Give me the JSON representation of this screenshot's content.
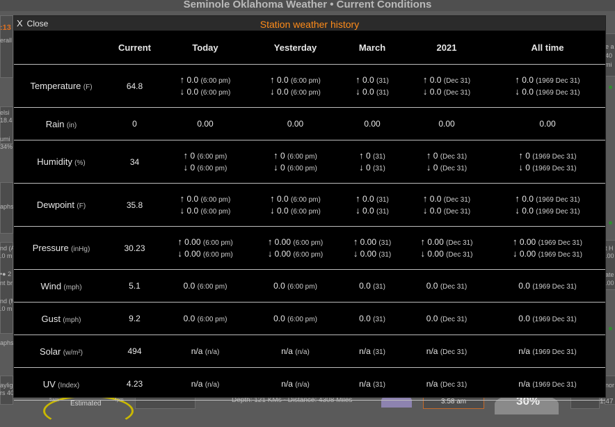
{
  "background": {
    "title": "Seminole Oklahoma Weather  •  Current Conditions",
    "fragments": {
      "top_left": ":13",
      "left_1": "erall",
      "left_2": "elsi",
      "left_3": "18.4",
      "left_4": "umi",
      "left_5": "34%",
      "left_6": "aphs",
      "left_7": "nd (A",
      "left_8": ".0 m",
      "left_9": "•● 2",
      "left_10": "nt br",
      "left_11": "nd (M",
      "left_12": ".0 m",
      "left_13": "aphs",
      "left_14": "ayligi",
      "left_15": "rs 40",
      "right_1": "e a",
      "right_2": "40",
      "right_3": "mi",
      "right_4": "t H",
      "right_5": ".00",
      "right_6": "ate",
      "right_7": ".00",
      "right_8": "nor",
      "right_9": "1:47",
      "bottom_estimated": "Estimated",
      "bottom_sam": "5am",
      "bottom_4pm": "4pm",
      "bottom_depth": "Depth: 121 KMs - Distance: 4308 Miles",
      "bottom_time": "3:58 am",
      "bottom_pct": "30%"
    }
  },
  "modal": {
    "close_label": "Close",
    "close_icon": "X",
    "title": "Station weather history",
    "title_color": "#ff8c1a",
    "columns": [
      "",
      "Current",
      "Today",
      "Yesterday",
      "March",
      "2021",
      "All time"
    ],
    "rows": [
      {
        "key": "temperature",
        "label": "Temperature",
        "unit": "(F)",
        "current": "64.8",
        "cells": [
          {
            "hi": "0.0",
            "hi_t": "(6:00 pm)",
            "lo": "0.0",
            "lo_t": "(6:00 pm)"
          },
          {
            "hi": "0.0",
            "hi_t": "(6:00 pm)",
            "lo": "0.0",
            "lo_t": "(6:00 pm)"
          },
          {
            "hi": "0.0",
            "hi_t": "(31)",
            "lo": "0.0",
            "lo_t": "(31)"
          },
          {
            "hi": "0.0",
            "hi_t": "(Dec 31)",
            "lo": "0.0",
            "lo_t": "(Dec 31)"
          },
          {
            "hi": "0.0",
            "hi_t": "(1969 Dec 31)",
            "lo": "0.0",
            "lo_t": "(1969 Dec 31)"
          }
        ]
      },
      {
        "key": "rain",
        "label": "Rain",
        "unit": "(in)",
        "current": "0",
        "cells": [
          {
            "v": "0.00"
          },
          {
            "v": "0.00"
          },
          {
            "v": "0.00"
          },
          {
            "v": "0.00"
          },
          {
            "v": "0.00"
          }
        ]
      },
      {
        "key": "humidity",
        "label": "Humidity",
        "unit": "(%)",
        "current": "34",
        "cells": [
          {
            "hi": "0",
            "hi_t": "(6:00 pm)",
            "lo": "0",
            "lo_t": "(6:00 pm)"
          },
          {
            "hi": "0",
            "hi_t": "(6:00 pm)",
            "lo": "0",
            "lo_t": "(6:00 pm)"
          },
          {
            "hi": "0",
            "hi_t": "(31)",
            "lo": "0",
            "lo_t": "(31)"
          },
          {
            "hi": "0",
            "hi_t": "(Dec 31)",
            "lo": "0",
            "lo_t": "(Dec 31)"
          },
          {
            "hi": "0",
            "hi_t": "(1969 Dec 31)",
            "lo": "0",
            "lo_t": "(1969 Dec 31)"
          }
        ]
      },
      {
        "key": "dewpoint",
        "label": "Dewpoint",
        "unit": "(F)",
        "current": "35.8",
        "cells": [
          {
            "hi": "0.0",
            "hi_t": "(6:00 pm)",
            "lo": "0.0",
            "lo_t": "(6:00 pm)"
          },
          {
            "hi": "0.0",
            "hi_t": "(6:00 pm)",
            "lo": "0.0",
            "lo_t": "(6:00 pm)"
          },
          {
            "hi": "0.0",
            "hi_t": "(31)",
            "lo": "0.0",
            "lo_t": "(31)"
          },
          {
            "hi": "0.0",
            "hi_t": "(Dec 31)",
            "lo": "0.0",
            "lo_t": "(Dec 31)"
          },
          {
            "hi": "0.0",
            "hi_t": "(1969 Dec 31)",
            "lo": "0.0",
            "lo_t": "(1969 Dec 31)"
          }
        ]
      },
      {
        "key": "pressure",
        "label": "Pressure",
        "unit": "(inHg)",
        "current": "30.23",
        "cells": [
          {
            "hi": "0.00",
            "hi_t": "(6:00 pm)",
            "lo": "0.00",
            "lo_t": "(6:00 pm)"
          },
          {
            "hi": "0.00",
            "hi_t": "(6:00 pm)",
            "lo": "0.00",
            "lo_t": "(6:00 pm)"
          },
          {
            "hi": "0.00",
            "hi_t": "(31)",
            "lo": "0.00",
            "lo_t": "(31)"
          },
          {
            "hi": "0.00",
            "hi_t": "(Dec 31)",
            "lo": "0.00",
            "lo_t": "(Dec 31)"
          },
          {
            "hi": "0.00",
            "hi_t": "(1969 Dec 31)",
            "lo": "0.00",
            "lo_t": "(1969 Dec 31)"
          }
        ]
      },
      {
        "key": "wind",
        "label": "Wind",
        "unit": "(mph)",
        "current": "5.1",
        "cells": [
          {
            "v": "0.0",
            "t": "(6:00 pm)"
          },
          {
            "v": "0.0",
            "t": "(6:00 pm)"
          },
          {
            "v": "0.0",
            "t": "(31)"
          },
          {
            "v": "0.0",
            "t": "(Dec 31)"
          },
          {
            "v": "0.0",
            "t": "(1969 Dec 31)"
          }
        ]
      },
      {
        "key": "gust",
        "label": "Gust",
        "unit": "(mph)",
        "current": "9.2",
        "cells": [
          {
            "v": "0.0",
            "t": "(6:00 pm)"
          },
          {
            "v": "0.0",
            "t": "(6:00 pm)"
          },
          {
            "v": "0.0",
            "t": "(31)"
          },
          {
            "v": "0.0",
            "t": "(Dec 31)"
          },
          {
            "v": "0.0",
            "t": "(1969 Dec 31)"
          }
        ]
      },
      {
        "key": "solar",
        "label": "Solar",
        "unit": "(w/m²)",
        "current": "494",
        "cells": [
          {
            "v": "n/a",
            "t": "(n/a)"
          },
          {
            "v": "n/a",
            "t": "(n/a)"
          },
          {
            "v": "n/a",
            "t": "(31)"
          },
          {
            "v": "n/a",
            "t": "(Dec 31)"
          },
          {
            "v": "n/a",
            "t": "(1969 Dec 31)"
          }
        ]
      },
      {
        "key": "uv",
        "label": "UV",
        "unit": "(Index)",
        "current": "4.23",
        "cells": [
          {
            "v": "n/a",
            "t": "(n/a)"
          },
          {
            "v": "n/a",
            "t": "(n/a)"
          },
          {
            "v": "n/a",
            "t": "(31)"
          },
          {
            "v": "n/a",
            "t": "(Dec 31)"
          },
          {
            "v": "n/a",
            "t": "(1969 Dec 31)"
          }
        ]
      }
    ],
    "arrows": {
      "up": "↑",
      "down": "↓"
    }
  }
}
